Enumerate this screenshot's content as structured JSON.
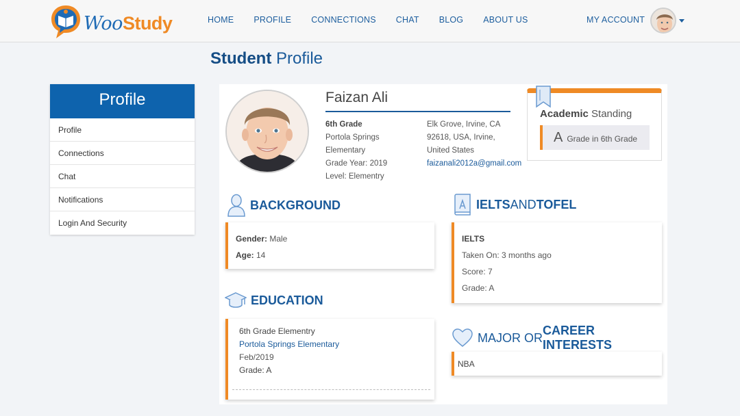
{
  "brand": {
    "name_part1": "Woo",
    "name_part2": "Study",
    "blue": "#1f6bb5",
    "orange": "#ef8a25"
  },
  "nav": [
    {
      "label": "HOME"
    },
    {
      "label": "PROFILE"
    },
    {
      "label": "CONNECTIONS"
    },
    {
      "label": "CHAT"
    },
    {
      "label": "BLOG"
    },
    {
      "label": "ABOUT US"
    }
  ],
  "account": {
    "label": "MY ACCOUNT"
  },
  "page_title": {
    "bold": "Student",
    "rest": " Profile"
  },
  "sidebar": {
    "title": "Profile",
    "items": [
      {
        "label": "Profile"
      },
      {
        "label": "Connections"
      },
      {
        "label": "Chat"
      },
      {
        "label": "Notifications"
      },
      {
        "label": "Login And Security"
      }
    ]
  },
  "profile": {
    "name": "Faizan Ali",
    "grade": "6th Grade",
    "school_line1": "Portola Springs",
    "school_line2": "Elementary",
    "grade_year": "Grade Year: 2019",
    "level": "Level: Elementry",
    "address_line1": "Elk Grove, Irvine, CA",
    "address_line2": "92618, USA, Irvine,",
    "address_line3": "United States",
    "email": "faizanali2012a@gmail.com"
  },
  "academic_standing": {
    "title_bold": "Academic",
    "title_rest": " Standing",
    "grade_letter": "A",
    "grade_text": "Grade in 6th Grade"
  },
  "background": {
    "title": "BACKGROUND",
    "gender_label": "Gender:",
    "gender_value": " Male",
    "age_label": "Age:",
    "age_value": " 14"
  },
  "education": {
    "title": "EDUCATION",
    "line1": "6th Grade Elementry",
    "school": "Portola Springs Elementary",
    "date": "Feb/2019",
    "grade": "Grade: A"
  },
  "ielts": {
    "title_part1": "IELTS",
    "title_part2": " AND ",
    "title_part3": "TOFEL",
    "test": "IELTS",
    "taken": "Taken On: 3 months ago",
    "score": "Score: 7",
    "grade": "Grade: A"
  },
  "interests": {
    "title_part1": "MAJOR OR ",
    "title_part2": "CAREER INTERESTS",
    "value": "NBA"
  }
}
